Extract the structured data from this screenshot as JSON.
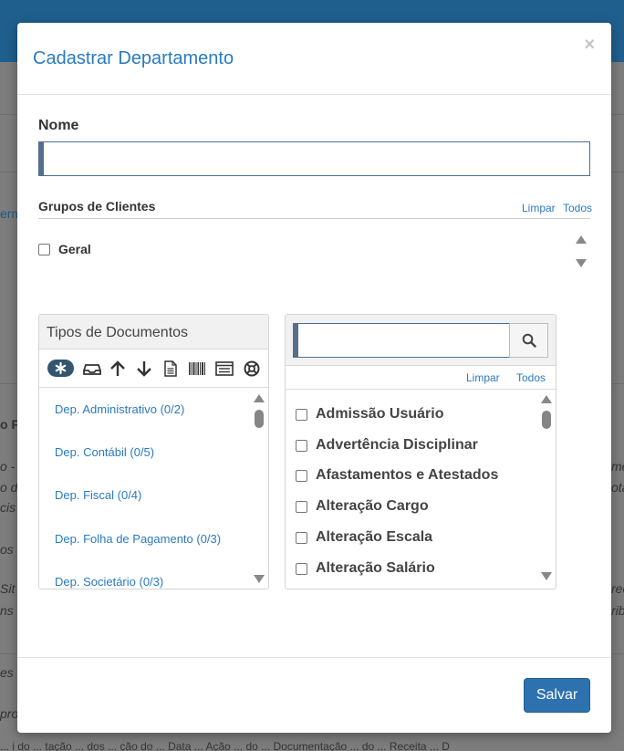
{
  "background": {
    "fragments": [
      "erm",
      "o F",
      "o -",
      "me",
      "o de",
      "ota",
      "cis",
      "os L",
      "Sit",
      "rec",
      "ns",
      "rib",
      "es",
      "pro",
      "... i do ... tação ... dos ... ção do ... Data ... Ação ... do ... Documentação ... do ... Receita ... D"
    ]
  },
  "modal": {
    "title": "Cadastrar Departamento",
    "close": "×",
    "nome_label": "Nome",
    "nome_value": "",
    "grupos_label": "Grupos de Clientes",
    "grupos_limpar": "Limpar",
    "grupos_todos": "Todos",
    "grupos_items": [
      {
        "label": "Geral",
        "checked": false
      }
    ],
    "tipos_title": "Tipos de Documentos",
    "toolbar_icons": [
      "asterisk-icon",
      "inbox-icon",
      "arrow-up-icon",
      "arrow-down-icon",
      "file-icon",
      "barcode-icon",
      "list-icon",
      "lifebuoy-icon"
    ],
    "departments": [
      "Dep. Administrativo (0/2)",
      "Dep. Contábil (0/5)",
      "Dep. Fiscal (0/4)",
      "Dep. Folha de Pagamento (0/3)",
      "Dep. Societário (0/3)"
    ],
    "search_value": "",
    "docs_limpar": "Limpar",
    "docs_todos": "Todos",
    "documents": [
      {
        "label": "Admissão Usuário",
        "checked": false
      },
      {
        "label": "Advertência Disciplinar",
        "checked": false
      },
      {
        "label": "Afastamentos e Atestados",
        "checked": false
      },
      {
        "label": "Alteração Cargo",
        "checked": false
      },
      {
        "label": "Alteração Escala",
        "checked": false
      },
      {
        "label": "Alteração Salário",
        "checked": false
      }
    ],
    "save_label": "Salvar"
  }
}
